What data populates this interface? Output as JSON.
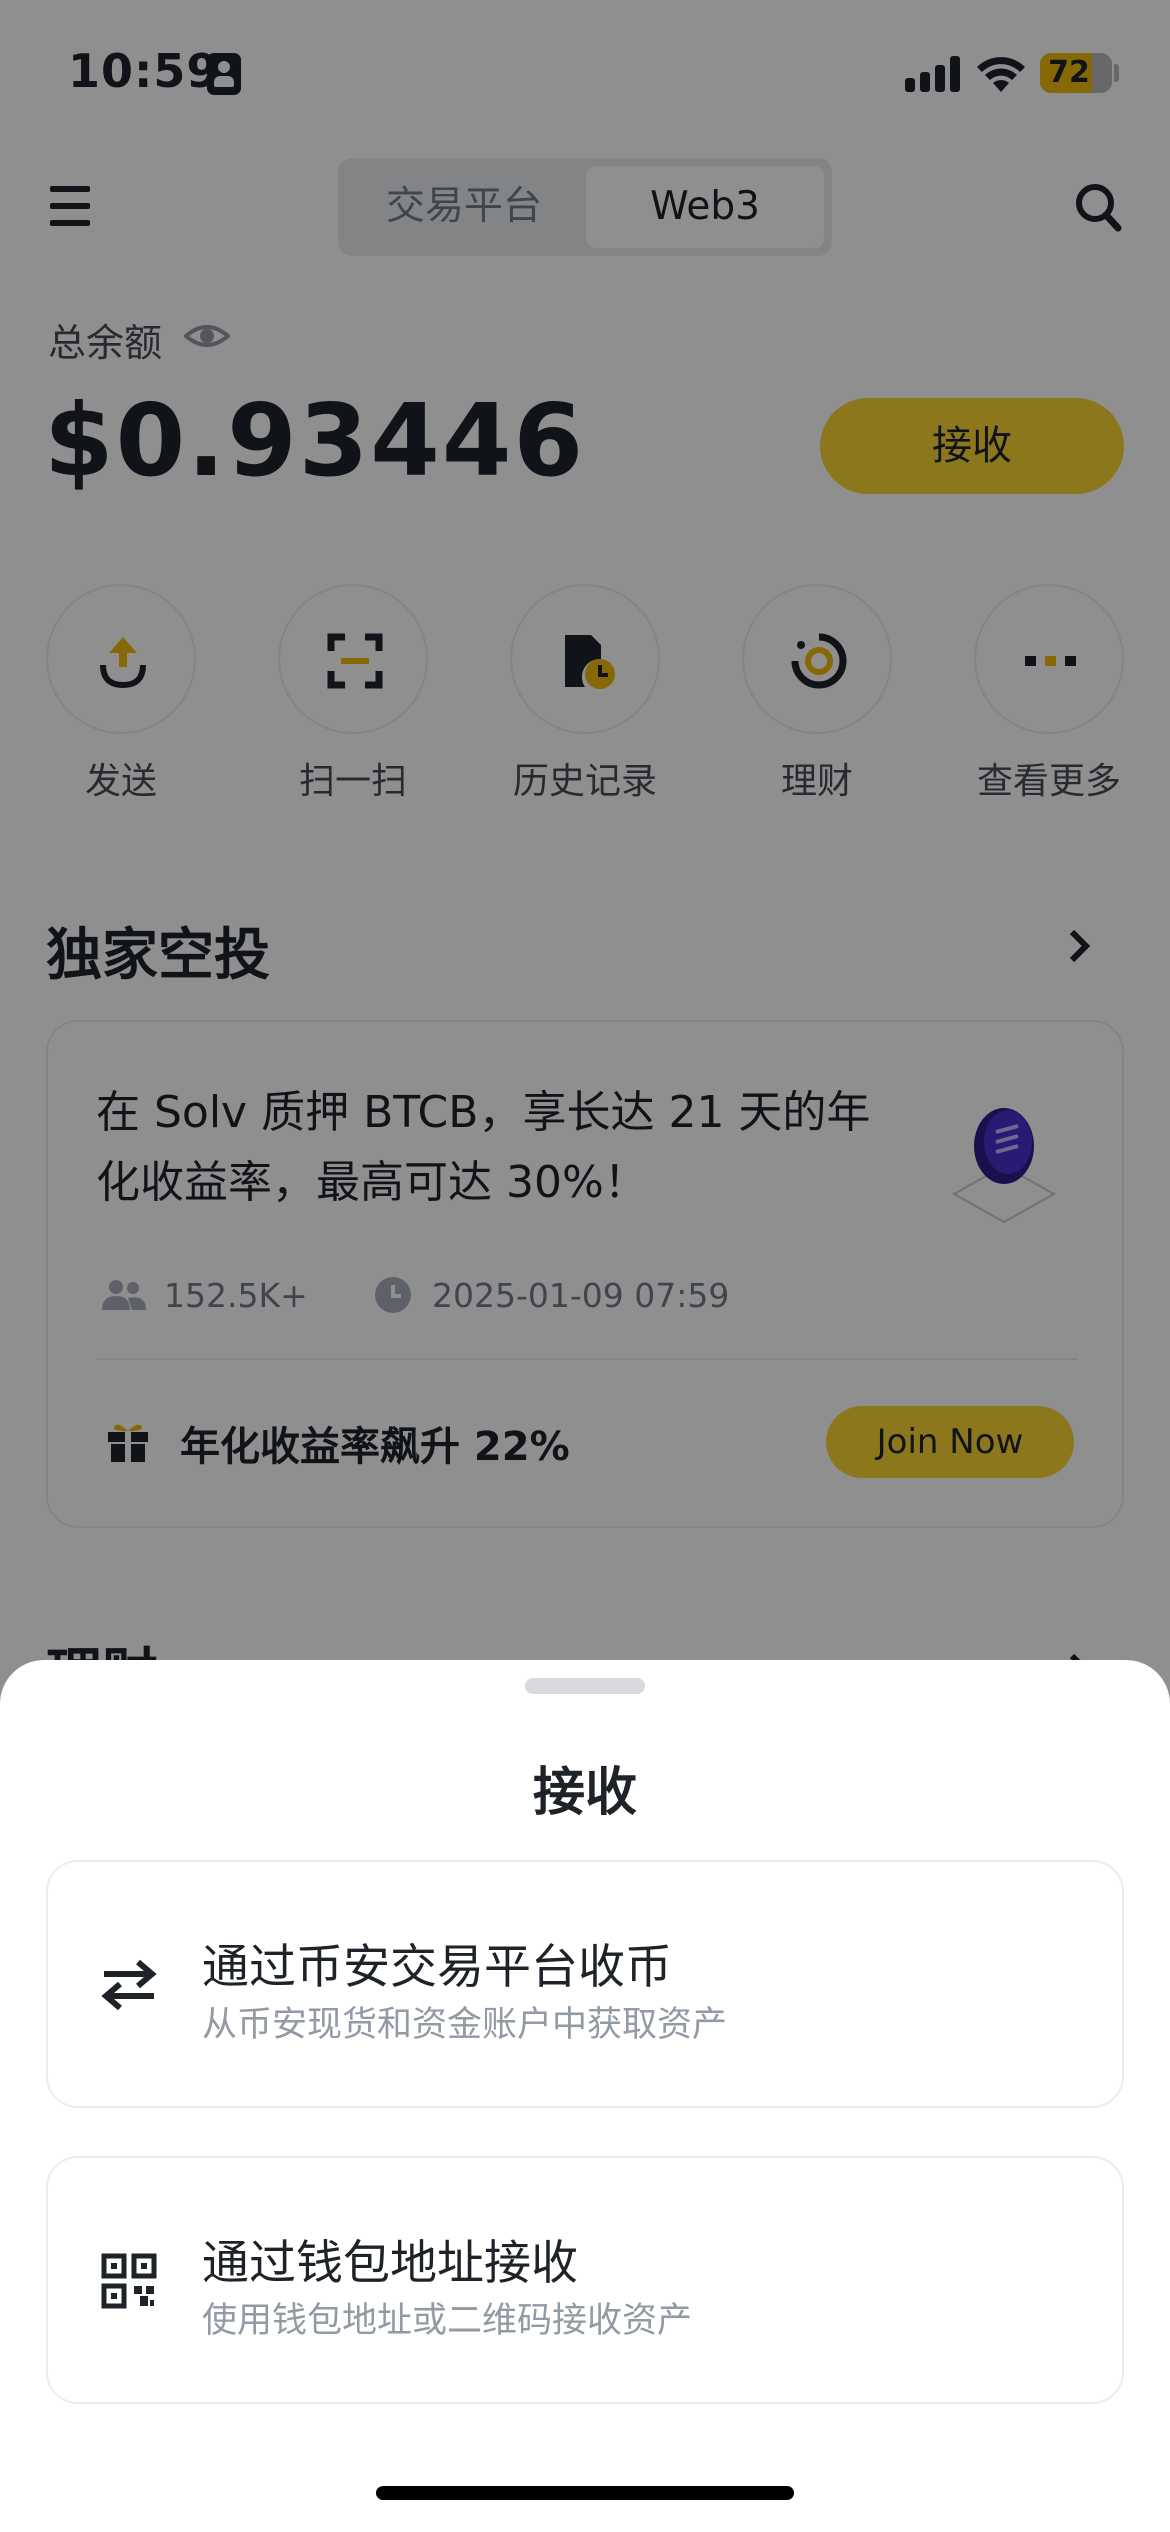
{
  "status_bar": {
    "time": "10:59",
    "battery": "72",
    "battery_level": 0.72
  },
  "nav": {
    "tabs": [
      "交易平台",
      "Web3"
    ],
    "active_tab": "Web3"
  },
  "balance": {
    "label": "总余额",
    "value": "$0.93446",
    "receive_label": "接收"
  },
  "actions": [
    {
      "label": "发送",
      "icon": "send-icon"
    },
    {
      "label": "扫一扫",
      "icon": "scan-icon"
    },
    {
      "label": "历史记录",
      "icon": "history-icon"
    },
    {
      "label": "理财",
      "icon": "earn-icon"
    },
    {
      "label": "查看更多",
      "icon": "more-icon"
    }
  ],
  "airdrop": {
    "title": "独家空投",
    "description": "在 Solv 质押 BTCB，享长达 21 天的年化收益率，最高可达 30%！",
    "participants": "152.5K+",
    "time": "2025-01-09 07:59",
    "apr_text": "年化收益率飙升 22%",
    "cta": "Join Now"
  },
  "next_section": {
    "title": "理财"
  },
  "sheet": {
    "title": "接收",
    "options": [
      {
        "title": "通过币安交易平台收币",
        "subtitle": "从币安现货和资金账户中获取资产",
        "icon": "transfer-icon"
      },
      {
        "title": "通过钱包地址接收",
        "subtitle": "使用钱包地址或二维码接收资产",
        "icon": "qr-code-icon"
      }
    ]
  },
  "colors": {
    "brand_yellow": "#fcd535",
    "text_primary": "#1e2329",
    "text_secondary": "#707a8a"
  }
}
